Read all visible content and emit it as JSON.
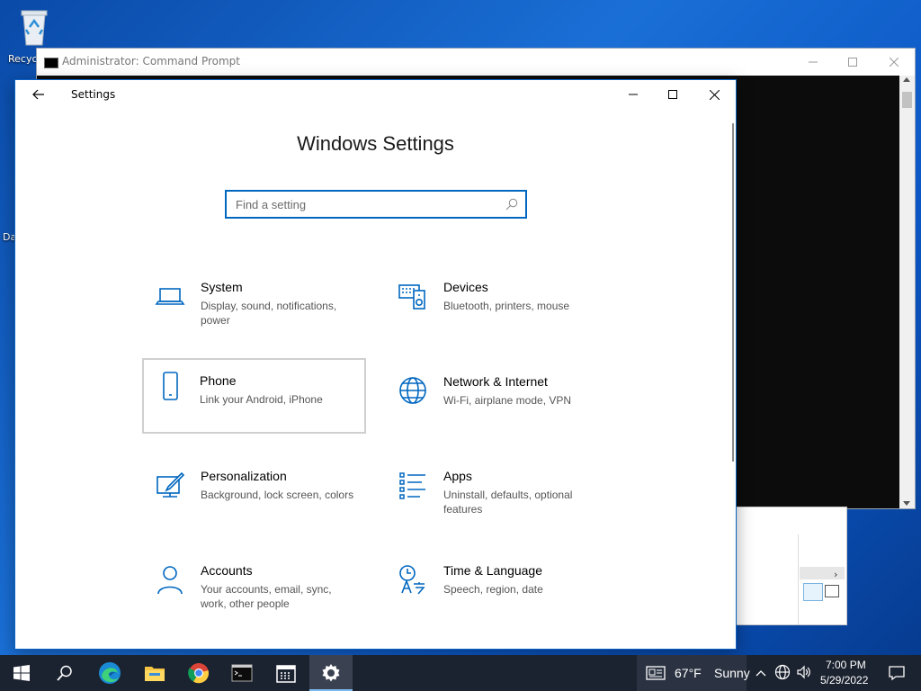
{
  "desktop": {
    "icons": [
      {
        "label": "Recyc"
      },
      {
        "label": "Da"
      }
    ]
  },
  "cmd_window": {
    "title": "Administrator: Command Prompt"
  },
  "settings": {
    "app_title": "Settings",
    "heading": "Windows Settings",
    "search_placeholder": "Find a setting",
    "tiles": [
      {
        "title": "System",
        "desc": "Display, sound, notifications, power",
        "icon": "laptop-icon"
      },
      {
        "title": "Devices",
        "desc": "Bluetooth, printers, mouse",
        "icon": "keyboard-speaker-icon"
      },
      {
        "title": "Phone",
        "desc": "Link your Android, iPhone",
        "icon": "phone-icon"
      },
      {
        "title": "Network & Internet",
        "desc": "Wi-Fi, airplane mode, VPN",
        "icon": "globe-icon"
      },
      {
        "title": "Personalization",
        "desc": "Background, lock screen, colors",
        "icon": "paint-brush-icon"
      },
      {
        "title": "Apps",
        "desc": "Uninstall, defaults, optional features",
        "icon": "apps-list-icon"
      },
      {
        "title": "Accounts",
        "desc": "Your accounts, email, sync, work, other people",
        "icon": "person-icon"
      },
      {
        "title": "Time & Language",
        "desc": "Speech, region, date",
        "icon": "time-language-icon"
      }
    ]
  },
  "taskbar": {
    "apps": [
      "start-icon",
      "search-icon",
      "edge-icon",
      "file-explorer-icon",
      "chrome-icon",
      "terminal-icon",
      "calendar-icon",
      "settings-gear-icon"
    ],
    "weather": {
      "temp": "67°F",
      "condition": "Sunny"
    },
    "time": "7:00 PM",
    "date": "5/29/2022"
  },
  "colors": {
    "accent": "#0067c0",
    "taskbar": "#1c2330",
    "desktop": "#0b56c4"
  }
}
